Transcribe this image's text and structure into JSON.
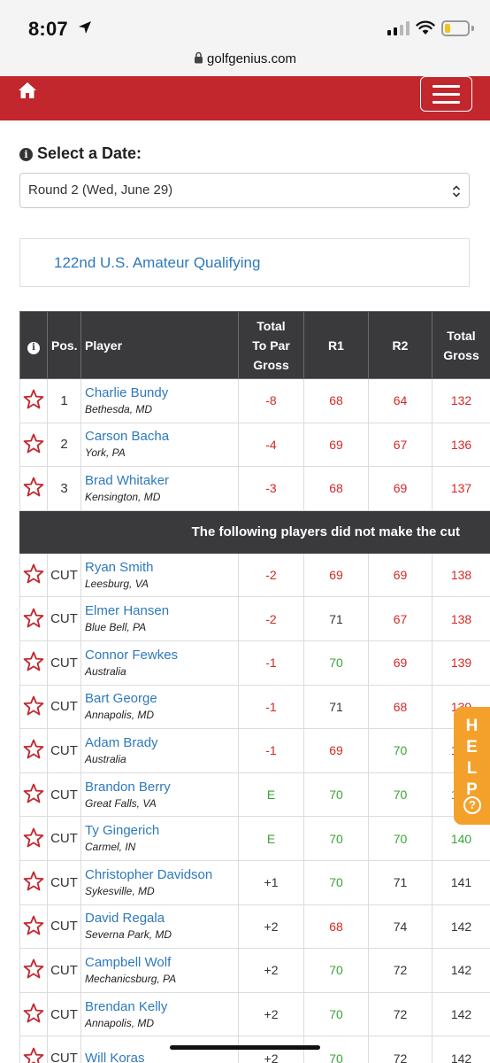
{
  "status_bar": {
    "time": "8:07"
  },
  "browser": {
    "url": "golfgenius.com"
  },
  "nav": {
    "home_icon": "home-icon",
    "menu_icon": "hamburger-menu-icon"
  },
  "date_selector": {
    "label": "Select a Date:",
    "selected": "Round 2 (Wed, June 29)"
  },
  "event": {
    "title": "122nd U.S. Amateur Qualifying"
  },
  "table": {
    "headers": {
      "info": "i",
      "pos": "Pos.",
      "player": "Player",
      "to_par_line1": "Total",
      "to_par_line2": "To Par",
      "to_par_line3": "Gross",
      "r1": "R1",
      "r2": "R2",
      "total_line1": "Total",
      "total_line2": "Gross"
    },
    "leaders": [
      {
        "pos": "1",
        "name": "Charlie Bundy",
        "city": "Bethesda, MD",
        "to_par": "-8",
        "r1": "68",
        "r2": "64",
        "total": "132"
      },
      {
        "pos": "2",
        "name": "Carson Bacha",
        "city": "York, PA",
        "to_par": "-4",
        "r1": "69",
        "r2": "67",
        "total": "136"
      },
      {
        "pos": "3",
        "name": "Brad Whitaker",
        "city": "Kensington, MD",
        "to_par": "-3",
        "r1": "68",
        "r2": "69",
        "total": "137"
      }
    ],
    "cut_message": "The following players did not make the cut",
    "cut_players": [
      {
        "pos": "CUT",
        "name": "Ryan Smith",
        "city": "Leesburg, VA",
        "to_par": "-2",
        "r1": "69",
        "r2": "69",
        "total": "138"
      },
      {
        "pos": "CUT",
        "name": "Elmer Hansen",
        "city": "Blue Bell, PA",
        "to_par": "-2",
        "r1": "71",
        "r2": "67",
        "total": "138"
      },
      {
        "pos": "CUT",
        "name": "Connor Fewkes",
        "city": "Australia",
        "to_par": "-1",
        "r1": "70",
        "r2": "69",
        "total": "139"
      },
      {
        "pos": "CUT",
        "name": "Bart George",
        "city": "Annapolis, MD",
        "to_par": "-1",
        "r1": "71",
        "r2": "68",
        "total": "139"
      },
      {
        "pos": "CUT",
        "name": "Adam Brady",
        "city": "Australia",
        "to_par": "-1",
        "r1": "69",
        "r2": "70",
        "total": "139"
      },
      {
        "pos": "CUT",
        "name": "Brandon Berry",
        "city": "Great Falls, VA",
        "to_par": "E",
        "r1": "70",
        "r2": "70",
        "total": "140"
      },
      {
        "pos": "CUT",
        "name": "Ty Gingerich",
        "city": "Carmel, IN",
        "to_par": "E",
        "r1": "70",
        "r2": "70",
        "total": "140"
      },
      {
        "pos": "CUT",
        "name": "Christopher Davidson",
        "city": "Sykesville, MD",
        "to_par": "+1",
        "r1": "70",
        "r2": "71",
        "total": "141"
      },
      {
        "pos": "CUT",
        "name": "David Regala",
        "city": "Severna Park, MD",
        "to_par": "+2",
        "r1": "68",
        "r2": "74",
        "total": "142"
      },
      {
        "pos": "CUT",
        "name": "Campbell Wolf",
        "city": "Mechanicsburg, PA",
        "to_par": "+2",
        "r1": "70",
        "r2": "72",
        "total": "142"
      },
      {
        "pos": "CUT",
        "name": "Brendan Kelly",
        "city": "Annapolis, MD",
        "to_par": "+2",
        "r1": "70",
        "r2": "72",
        "total": "142"
      },
      {
        "pos": "CUT",
        "name": "Will Koras",
        "city": "",
        "to_par": "+2",
        "r1": "70",
        "r2": "72",
        "total": "142"
      }
    ]
  },
  "help_tab": {
    "label": "HELP",
    "icon": "question-circle-icon"
  },
  "colors": {
    "nav_red": "#c1272d",
    "header_dark": "#3a3a3d",
    "link_blue": "#2e79bd",
    "under_par_red": "#d42828",
    "par_green": "#3aa33a",
    "help_orange": "#f4a12b"
  }
}
